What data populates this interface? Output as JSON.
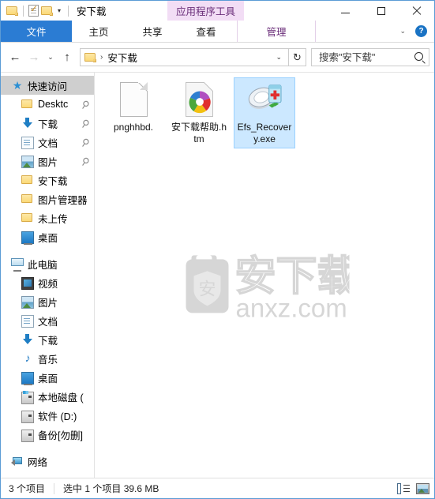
{
  "window": {
    "title": "安下载",
    "contextual_tab_group": "应用程序工具",
    "quick_access": {
      "folder_label": "folder-icon",
      "properties_label": "properties-icon",
      "new_folder_label": "new-folder-icon",
      "customize_label": "▾"
    },
    "controls": {
      "minimize": "minimize",
      "maximize": "maximize",
      "close": "close"
    }
  },
  "ribbon": {
    "tabs": [
      {
        "label": "文件",
        "state": "file"
      },
      {
        "label": "主页",
        "state": "normal"
      },
      {
        "label": "共享",
        "state": "normal"
      },
      {
        "label": "查看",
        "state": "normal"
      },
      {
        "label": "管理",
        "state": "contextual"
      }
    ],
    "collapse_chevron": "⌄",
    "help_label": "?"
  },
  "address": {
    "back": "←",
    "forward": "→",
    "history": "⌄",
    "up": "↑",
    "crumb_separator": "›",
    "path": "安下载",
    "dropdown": "⌄",
    "refresh": "↻",
    "search_placeholder": "搜索\"安下载\""
  },
  "sidebar": {
    "items": [
      {
        "label": "快速访问",
        "icon": "star-icon",
        "indent": 13,
        "selected": true,
        "pinned": false,
        "gap_before": false
      },
      {
        "label": "Desktc",
        "icon": "folder-icon",
        "indent": 26,
        "selected": false,
        "pinned": true,
        "gap_before": false
      },
      {
        "label": "下载",
        "icon": "download-icon",
        "indent": 26,
        "selected": false,
        "pinned": true,
        "gap_before": false
      },
      {
        "label": "文档",
        "icon": "document-icon",
        "indent": 26,
        "selected": false,
        "pinned": true,
        "gap_before": false
      },
      {
        "label": "图片",
        "icon": "picture-icon",
        "indent": 26,
        "selected": false,
        "pinned": true,
        "gap_before": false
      },
      {
        "label": "安下载",
        "icon": "folder-icon",
        "indent": 26,
        "selected": false,
        "pinned": false,
        "gap_before": false
      },
      {
        "label": "图片管理器",
        "icon": "folder-icon",
        "indent": 26,
        "selected": false,
        "pinned": false,
        "gap_before": false
      },
      {
        "label": "未上传",
        "icon": "folder-icon",
        "indent": 26,
        "selected": false,
        "pinned": false,
        "gap_before": false
      },
      {
        "label": "桌面",
        "icon": "desktop-icon",
        "indent": 26,
        "selected": false,
        "pinned": false,
        "gap_before": false
      },
      {
        "label": "此电脑",
        "icon": "pc-icon",
        "indent": 13,
        "selected": false,
        "pinned": false,
        "gap_before": true
      },
      {
        "label": "视频",
        "icon": "video-icon",
        "indent": 26,
        "selected": false,
        "pinned": false,
        "gap_before": false
      },
      {
        "label": "图片",
        "icon": "picture-icon",
        "indent": 26,
        "selected": false,
        "pinned": false,
        "gap_before": false
      },
      {
        "label": "文档",
        "icon": "document-icon",
        "indent": 26,
        "selected": false,
        "pinned": false,
        "gap_before": false
      },
      {
        "label": "下载",
        "icon": "download-icon",
        "indent": 26,
        "selected": false,
        "pinned": false,
        "gap_before": false
      },
      {
        "label": "音乐",
        "icon": "music-icon",
        "indent": 26,
        "selected": false,
        "pinned": false,
        "gap_before": false
      },
      {
        "label": "桌面",
        "icon": "desktop-icon",
        "indent": 26,
        "selected": false,
        "pinned": false,
        "gap_before": false
      },
      {
        "label": "本地磁盘 (",
        "icon": "system-drive-icon",
        "indent": 26,
        "selected": false,
        "pinned": false,
        "gap_before": false
      },
      {
        "label": "软件 (D:)",
        "icon": "drive-icon",
        "indent": 26,
        "selected": false,
        "pinned": false,
        "gap_before": false
      },
      {
        "label": "备份[勿删]",
        "icon": "drive-icon",
        "indent": 26,
        "selected": false,
        "pinned": false,
        "gap_before": false
      },
      {
        "label": "网络",
        "icon": "network-icon",
        "indent": 13,
        "selected": false,
        "pinned": false,
        "gap_before": true
      }
    ]
  },
  "content": {
    "files": [
      {
        "name": "pnghhbd.",
        "icon": "blank-document-icon",
        "selected": false
      },
      {
        "name": "安下载帮助.htm",
        "icon": "html-document-icon",
        "selected": false
      },
      {
        "name": "Efs_Recovery.exe",
        "icon": "application-exe-icon",
        "selected": true
      }
    ],
    "watermark": {
      "cn_text": "安下载",
      "badge_text": "安",
      "url_text": "anxz.com",
      "color": "#d6d6d6"
    }
  },
  "statusbar": {
    "item_count": "3 个项目",
    "selection": "选中 1 个项目  39.6 MB",
    "view_details": "details-view",
    "view_large_icons": "large-icons-view"
  },
  "colors": {
    "accent_blue": "#2b7cd3",
    "selection_blue": "#cce8ff",
    "contextual_purple": "#f2ddf5",
    "contextual_text": "#6b2f7a",
    "window_border": "#5b9bd5"
  }
}
